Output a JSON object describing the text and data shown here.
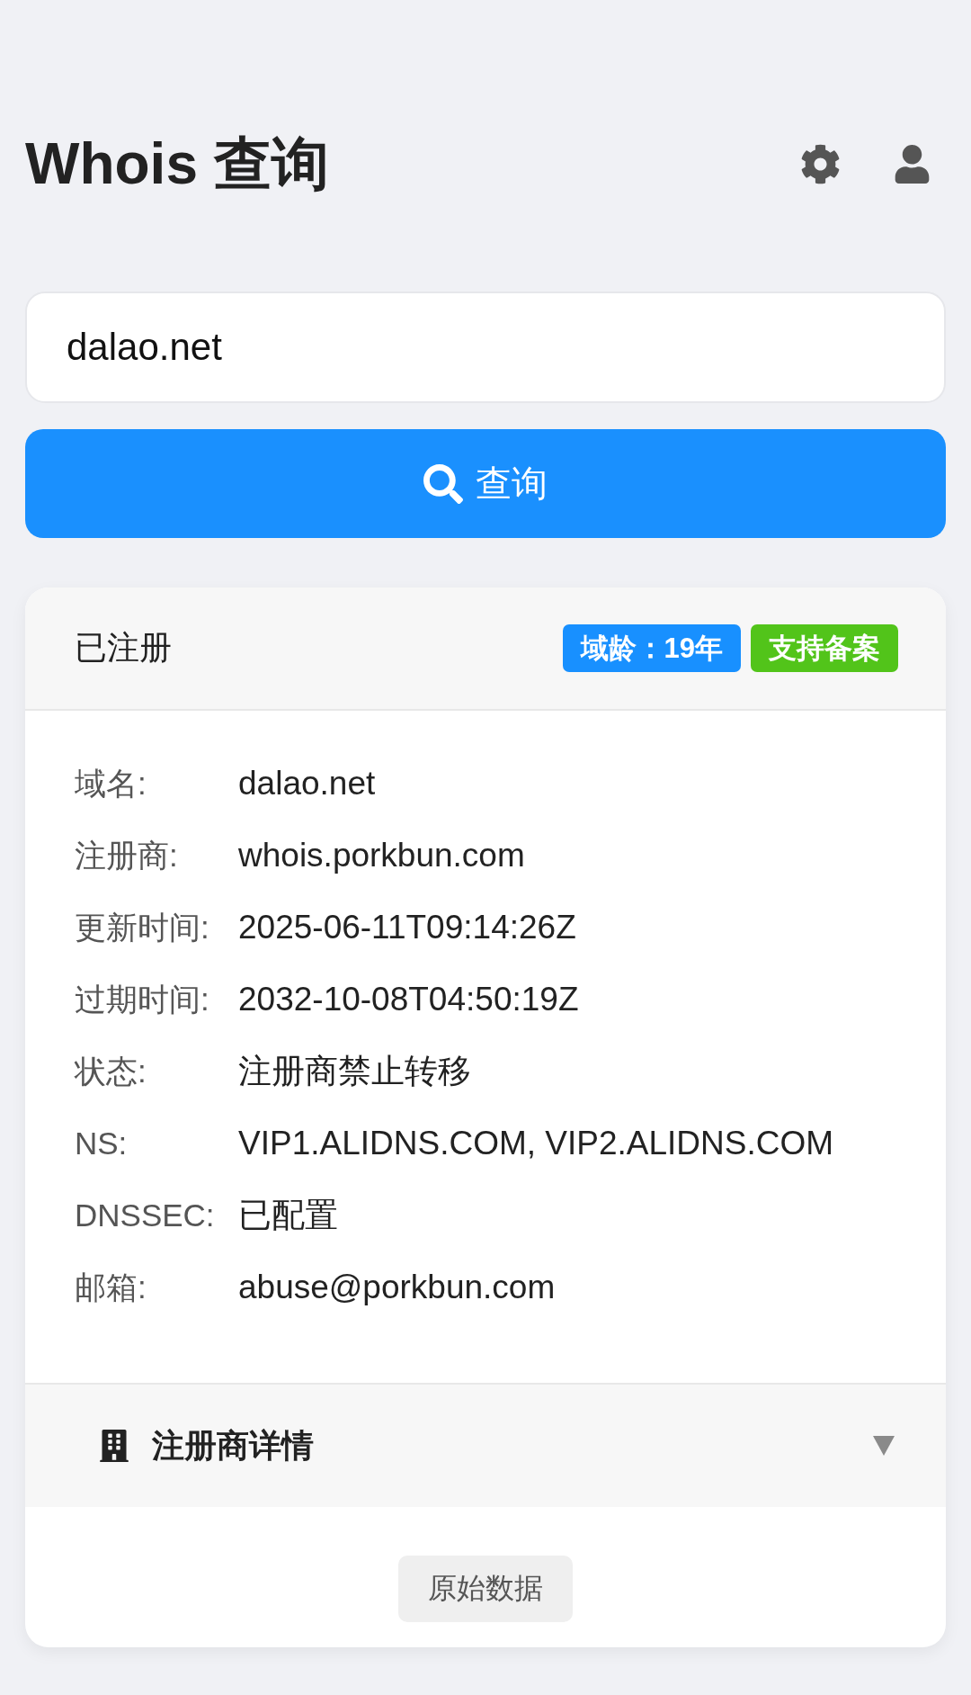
{
  "header": {
    "title": "Whois 查询"
  },
  "search": {
    "value": "dalao.net"
  },
  "query_button": {
    "label": "查询"
  },
  "result": {
    "status": "已注册",
    "badges": [
      {
        "label": "域龄：19年",
        "color": "#1890ff"
      },
      {
        "label": "支持备案",
        "color": "#52c41a"
      }
    ],
    "fields": [
      {
        "label": "域名:",
        "value": "dalao.net"
      },
      {
        "label": "注册商:",
        "value": "whois.porkbun.com"
      },
      {
        "label": "更新时间:",
        "value": "2025-06-11T09:14:26Z"
      },
      {
        "label": "过期时间:",
        "value": "2032-10-08T04:50:19Z"
      },
      {
        "label": "状态:",
        "value": "注册商禁止转移"
      },
      {
        "label": "NS:",
        "value": "VIP1.ALIDNS.COM, VIP2.ALIDNS.COM"
      },
      {
        "label": "DNSSEC:",
        "value": "已配置"
      },
      {
        "label": "邮箱:",
        "value": "abuse@porkbun.com"
      }
    ],
    "registrar_section": {
      "title": "注册商详情",
      "expanded": false
    },
    "raw_button": {
      "label": "原始数据"
    }
  }
}
